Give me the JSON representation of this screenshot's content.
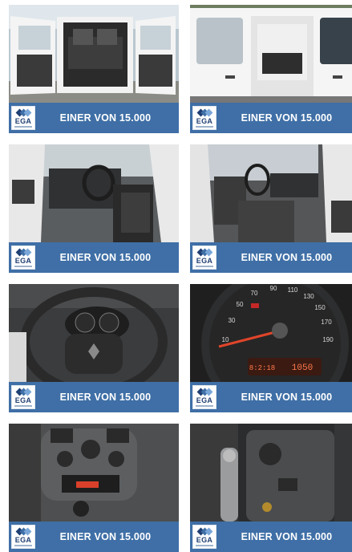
{
  "banner": {
    "text": "EINER VON 15.000",
    "logo_text": "EGA",
    "logo_icon": "ega-diamonds-icon"
  },
  "colors": {
    "banner_bg": "#3f6fa6",
    "banner_text": "#ffffff",
    "logo_blue_dark": "#1f3f73",
    "logo_blue_mid": "#3f6fa6",
    "logo_blue_light": "#7aa7d8"
  },
  "tiles": [
    {
      "photo": "van-rear-open-doors",
      "text": "EINER VON 15.000",
      "logo": "EGA"
    },
    {
      "photo": "van-side-sliding-door",
      "text": "EINER VON 15.000",
      "logo": "EGA"
    },
    {
      "photo": "interior-driver-side",
      "text": "EINER VON 15.000",
      "logo": "EGA"
    },
    {
      "photo": "interior-passenger-side",
      "text": "EINER VON 15.000",
      "logo": "EGA"
    },
    {
      "photo": "steering-wheel-dashboard",
      "text": "EINER VON 15.000",
      "logo": "EGA"
    },
    {
      "photo": "speedometer-closeup",
      "text": "EINER VON 15.000",
      "logo": "EGA"
    },
    {
      "photo": "center-console-radio",
      "text": "EINER VON 15.000",
      "logo": "EGA"
    },
    {
      "photo": "handbrake-console",
      "text": "EINER VON 15.000",
      "logo": "EGA"
    }
  ],
  "speedometer": {
    "ticks": [
      "10",
      "30",
      "50",
      "70",
      "90",
      "110",
      "130",
      "150",
      "170",
      "190"
    ],
    "odometer_left": "8:2:18",
    "odometer_right": "1050"
  }
}
